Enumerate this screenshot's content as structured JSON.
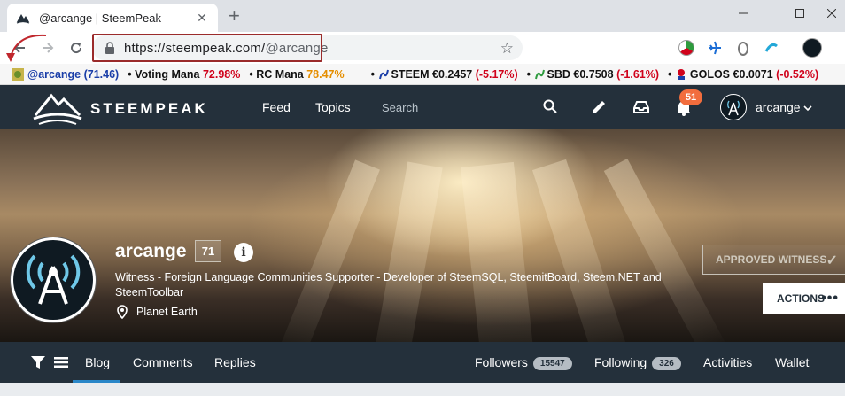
{
  "browser": {
    "tab_title": "@arcange | SteemPeak",
    "new_tab": "+",
    "tab_close": "✕",
    "url_host": "https://steempeak.com/",
    "url_path": "@arcange"
  },
  "ticker": {
    "account": "@arcange (71.46)",
    "voting_label": "Voting Mana",
    "voting_value": "72.98%",
    "rc_label": "RC Mana",
    "rc_value": "78.47%",
    "steem_label": "STEEM €0.2457",
    "steem_change": "(-5.17%)",
    "sbd_label": "SBD €0.7508",
    "sbd_change": "(-1.61%)",
    "golos_label": "GOLOS €0.0071",
    "golos_change": "(-0.52%)",
    "bullet": "•"
  },
  "header": {
    "logo_text": "STEEMPEAK",
    "nav_feed": "Feed",
    "nav_topics": "Topics",
    "search_placeholder": "Search",
    "notifications_count": "51",
    "username": "arcange"
  },
  "profile": {
    "name": "arcange",
    "reputation": "71",
    "info": "i",
    "description": "Witness - Foreign Language Communities Supporter - Developer of SteemSQL, SteemitBoard, Steem.NET and SteemToolbar",
    "location": "Planet Earth",
    "witness_button": "APPROVED WITNESS",
    "actions_button": "ACTIONS"
  },
  "tabs": {
    "blog": "Blog",
    "comments": "Comments",
    "replies": "Replies",
    "followers": "Followers",
    "followers_count": "15547",
    "following": "Following",
    "following_count": "326",
    "activities": "Activities",
    "wallet": "Wallet"
  },
  "colors": {
    "header_bg": "#24303b",
    "accent_blue": "#2a87c8",
    "badge_orange": "#f26d3d",
    "negative_red": "#d0021b",
    "mana_orange": "#e58e00"
  }
}
